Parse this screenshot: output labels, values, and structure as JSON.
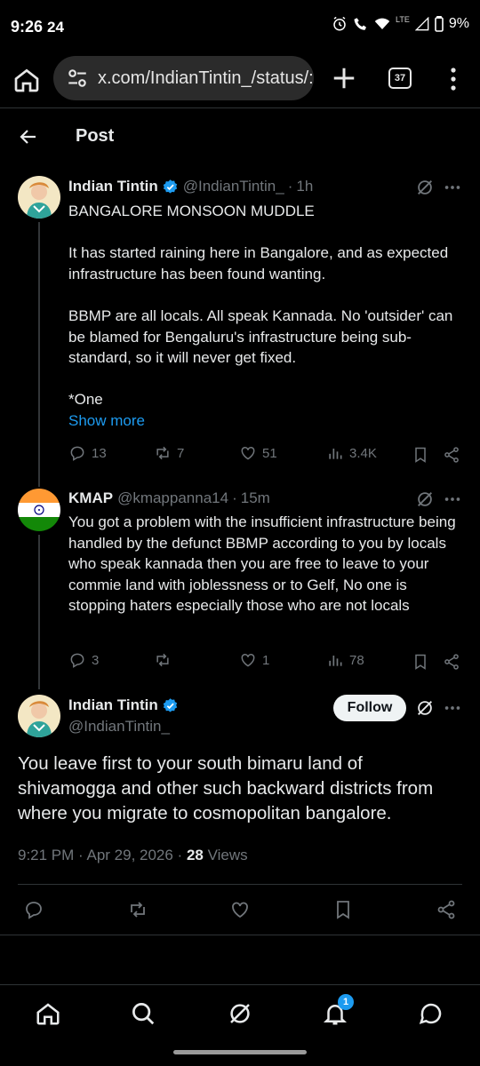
{
  "status_bar": {
    "time": "9:26",
    "time_icon": "24",
    "lte": "LTE",
    "battery": "9%"
  },
  "browser": {
    "url": "x.com/IndianTintin_/status/:",
    "tab_count": "37"
  },
  "header": {
    "title": "Post"
  },
  "tweet1": {
    "name": "Indian Tintin",
    "handle": "@IndianTintin_",
    "time": "1h",
    "body": {
      "l1": "BANGALORE MONSOON MUDDLE",
      "l2": "It has started raining here in Bangalore, and as expected infrastructure has been found wanting.",
      "l3": "BBMP are all locals. All speak Kannada. No 'outsider' can be blamed for Bengaluru's infrastructure being sub-standard, so it will never get fixed.",
      "l4": "*One",
      "show_more": "Show more"
    },
    "replies": "13",
    "reposts": "7",
    "likes": "51",
    "views": "3.4K"
  },
  "tweet2": {
    "name": "KMAP",
    "handle": "@kmappanna14",
    "time": "15m",
    "body": "You got a problem with the insufficient infrastructure being handled by the defunct BBMP according to you by locals who speak kannada then you are free to leave to your commie land with joblessness or to Gelf, No one is stopping haters especially those who are not locals",
    "replies": "3",
    "likes": "1",
    "views": "78"
  },
  "main_tweet": {
    "name": "Indian Tintin",
    "handle": "@IndianTintin_",
    "follow_label": "Follow",
    "text": "You leave first to your south bimaru land of shivamogga and other such backward districts from where you migrate to cosmopolitan bangalore.",
    "timestamp": "9:21 PM · Apr 29, 2026 · ",
    "views_count": "28",
    "views_label": " Views"
  },
  "bottom_nav": {
    "notification_badge": "1"
  },
  "colors": {
    "accent": "#1d9bf0",
    "muted": "#71767b",
    "text": "#e7e9ea",
    "border": "#2f3336"
  }
}
